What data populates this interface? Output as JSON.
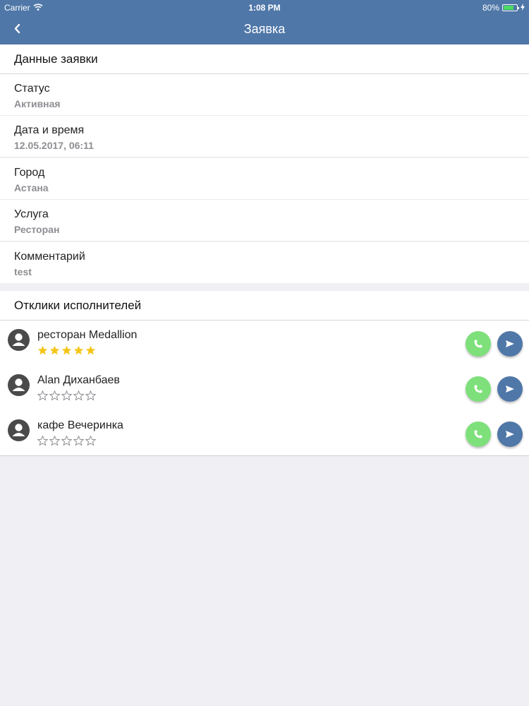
{
  "status_bar": {
    "carrier": "Carrier",
    "time": "1:08 PM",
    "battery": "80%",
    "battery_level": 0.8
  },
  "nav": {
    "title": "Заявка"
  },
  "details": {
    "header": "Данные заявки",
    "fields": [
      {
        "label": "Статус",
        "value": "Активная"
      },
      {
        "label": "Дата и время",
        "value": "12.05.2017, 06:11"
      },
      {
        "label": "Город",
        "value": "Астана"
      },
      {
        "label": "Услуга",
        "value": "Ресторан"
      },
      {
        "label": "Комментарий",
        "value": "test"
      }
    ]
  },
  "responses": {
    "header": "Отклики исполнителей",
    "items": [
      {
        "name": "ресторан Medallion",
        "rating": 5
      },
      {
        "name": "Alan Диханбаев",
        "rating": 0
      },
      {
        "name": "кафе Вечеринка",
        "rating": 0
      }
    ]
  },
  "colors": {
    "nav_bg": "#4f77a8",
    "call_button": "#7ee07a",
    "send_button": "#4f77a8",
    "star_filled": "#f5c518",
    "star_empty": "#8e8e93"
  }
}
